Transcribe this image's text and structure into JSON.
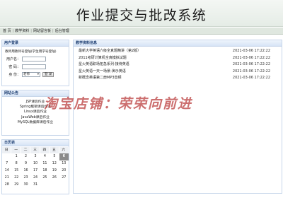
{
  "header": {
    "title": "作业提交与批改系统"
  },
  "nav": {
    "items": [
      "首 页",
      "教学资料",
      "网站留言板",
      "后台管理"
    ]
  },
  "login": {
    "heading": "用户登录",
    "note": "教师用教师号登陆(学生用学号登陆)",
    "username_label": "用户名：",
    "password_label": "密 码：",
    "identity_label": "身 份：",
    "identity_value": "老师",
    "login_button": "登 录"
  },
  "notices": {
    "heading": "网站公告",
    "items": [
      "JSP课后作业",
      "Spring框架课后作业",
      "Linux课后作业",
      "JavaWeb课后作业",
      "MySQL数据库课后作业"
    ]
  },
  "calendar": {
    "heading": "日历表",
    "weekdays": [
      "日",
      "一",
      "二",
      "三",
      "四",
      "五",
      "六"
    ],
    "days": [
      "",
      "1",
      "2",
      "3",
      "4",
      "5",
      "6",
      "7",
      "8",
      "9",
      "10",
      "11",
      "12",
      "13",
      "14",
      "15",
      "16",
      "17",
      "18",
      "19",
      "20",
      "21",
      "22",
      "23",
      "24",
      "25",
      "26",
      "27",
      "28",
      "29",
      "30",
      "31",
      "",
      "",
      ""
    ],
    "today": "6"
  },
  "resources": {
    "heading": "教学资料信息",
    "items": [
      {
        "title": "最新大学英语六级全真题精讲（第2版）",
        "date": "2021-03-06 17:22:22"
      },
      {
        "title": "2011考研计算机全真模拟试题",
        "date": "2021-03-06 17:22:22"
      },
      {
        "title": "星火英语职场拓急系列-接待英语",
        "date": "2021-03-06 17:22:22"
      },
      {
        "title": "星火英语一天一场景-演示英语",
        "date": "2021-03-06 17:22:22"
      },
      {
        "title": "新概念英语第二册MP3音频",
        "date": "2021-03-06 17:22:22"
      }
    ]
  },
  "watermark": {
    "text": "淘宝店铺：荣荣向前进"
  }
}
